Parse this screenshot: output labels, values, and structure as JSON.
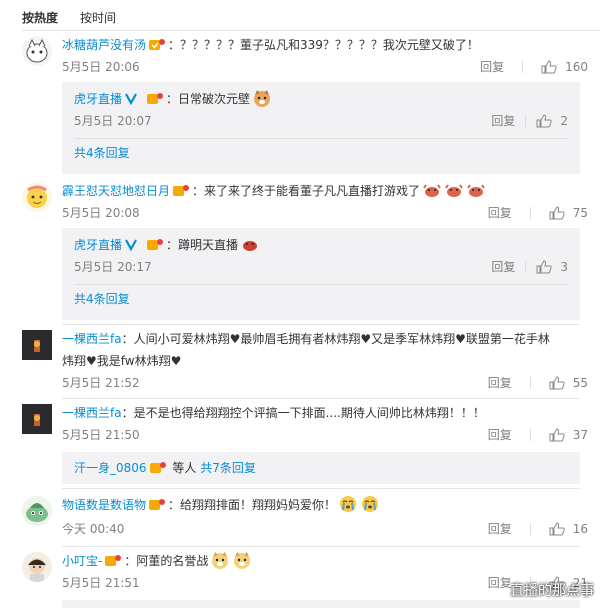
{
  "tabs": {
    "hot": "按热度",
    "time": "按时间"
  },
  "comments": [
    {
      "user": "冰糖葫芦没有汤",
      "text": "：？？？？？董子弘凡和339？？？？？我次元壁又破了！",
      "time": "5月5日 20:06",
      "reply": "回复",
      "likes": "160",
      "replies": [
        {
          "user": "虎牙直播",
          "text": "：日常破次元壁",
          "time": "5月5日 20:07",
          "reply": "回复",
          "likes": "2"
        }
      ],
      "more": "共4条回复"
    },
    {
      "user": "霹王怼天怼地怼日月",
      "text": "：来了来了终于能看董子凡凡直播打游戏了",
      "time": "5月5日 20:08",
      "reply": "回复",
      "likes": "75",
      "replies": [
        {
          "user": "虎牙直播",
          "text": "：蹲明天直播",
          "time": "5月5日 20:17",
          "reply": "回复",
          "likes": "3"
        }
      ],
      "more": "共4条回复"
    },
    {
      "user": "一棵西兰fa",
      "text_line1": "：人间小可爱林炜翔♥最帅眉毛拥有者林炜翔♥又是季军林炜翔♥联盟第一花手林",
      "text_line2": "炜翔♥我是fw林炜翔♥",
      "time": "5月5日 21:52",
      "reply": "回复",
      "likes": "55"
    },
    {
      "user": "一棵西兰fa",
      "text": "：是不是也得给翔翔控个评搞一下排面....期待人间帅比林炜翔！！！",
      "time": "5月5日 21:50",
      "reply": "回复",
      "likes": "37",
      "sub_user": "汗一身_0806",
      "sub_text": " 等人 ",
      "sub_more": "共7条回复"
    },
    {
      "user": "物语数是数语物",
      "text": "：给翔翔排面！翔翔妈妈爱你！",
      "time": "今天 00:40",
      "reply": "回复",
      "likes": "16"
    },
    {
      "user": "小叮宝-",
      "text": "：阿董的名誉战",
      "time": "5月5日 21:51",
      "reply": "回复",
      "likes": "21"
    }
  ],
  "watermark": "直播的那点事",
  "colors": {
    "link": "#0a8cd2",
    "name": "#eb7350",
    "reply_bg": "#f2f2f5"
  }
}
